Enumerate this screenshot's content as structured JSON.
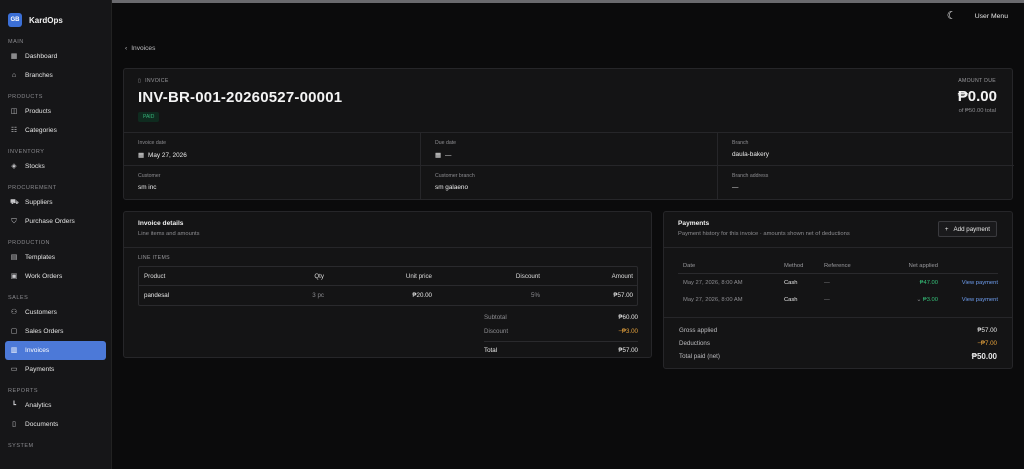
{
  "sidebar": {
    "brand": {
      "logo": "GB",
      "name": "KardOps"
    },
    "sections": [
      {
        "title": "MAIN",
        "items": [
          {
            "label": "Dashboard",
            "icon": "grid-icon"
          },
          {
            "label": "Branches",
            "icon": "store-icon"
          }
        ]
      },
      {
        "title": "PRODUCTS",
        "items": [
          {
            "label": "Products",
            "icon": "box-icon"
          },
          {
            "label": "Categories",
            "icon": "category-icon"
          }
        ]
      },
      {
        "title": "INVENTORY",
        "items": [
          {
            "label": "Stocks",
            "icon": "stock-icon"
          }
        ]
      },
      {
        "title": "PROCUREMENT",
        "items": [
          {
            "label": "Suppliers",
            "icon": "truck-icon"
          },
          {
            "label": "Purchase Orders",
            "icon": "cart-icon"
          }
        ]
      },
      {
        "title": "PRODUCTION",
        "items": [
          {
            "label": "Templates",
            "icon": "template-icon"
          },
          {
            "label": "Work Orders",
            "icon": "workorder-icon"
          }
        ]
      },
      {
        "title": "SALES",
        "items": [
          {
            "label": "Customers",
            "icon": "users-icon"
          },
          {
            "label": "Sales Orders",
            "icon": "order-icon"
          },
          {
            "label": "Invoices",
            "icon": "invoice-icon",
            "active": true
          },
          {
            "label": "Payments",
            "icon": "card-icon"
          }
        ]
      },
      {
        "title": "REPORTS",
        "items": [
          {
            "label": "Analytics",
            "icon": "chart-icon"
          },
          {
            "label": "Documents",
            "icon": "document-icon"
          }
        ]
      },
      {
        "title": "SYSTEM",
        "items": []
      }
    ]
  },
  "topbar": {
    "user_menu": "User Menu"
  },
  "back_link": "Invoices",
  "invoice": {
    "label": "INVOICE",
    "number": "INV-BR-001-20260527-00001",
    "status": "PAID",
    "amount_due_label": "AMOUNT DUE",
    "amount_due": "₱0.00",
    "amount_total": "of ₱50.00 total",
    "meta": {
      "invoice_date_label": "Invoice date",
      "invoice_date": "May 27, 2026",
      "due_date_label": "Due date",
      "due_date": "—",
      "branch_label": "Branch",
      "branch": "daula-bakery",
      "customer_label": "Customer",
      "customer": "sm inc",
      "customer_branch_label": "Customer branch",
      "customer_branch": "sm galaeno",
      "branch_address_label": "Branch address",
      "branch_address": "—"
    }
  },
  "details": {
    "title": "Invoice details",
    "subtitle": "Line items and amounts",
    "line_items_label": "LINE ITEMS",
    "columns": [
      "Product",
      "Qty",
      "Unit price",
      "Discount",
      "Amount"
    ],
    "rows": [
      {
        "product": "pandesal",
        "qty": "3 pc",
        "unit_price": "₱20.00",
        "discount": "5%",
        "amount": "₱57.00"
      }
    ],
    "subtotal_label": "Subtotal",
    "subtotal": "₱60.00",
    "discount_label": "Discount",
    "discount": "−₱3.00",
    "total_label": "Total",
    "total": "₱57.00"
  },
  "payments": {
    "title": "Payments",
    "subtitle": "Payment history for this invoice · amounts shown net of deductions",
    "add_label": "Add payment",
    "columns": [
      "Date",
      "Method",
      "Reference",
      "Net applied"
    ],
    "rows": [
      {
        "date": "May 27, 2026, 8:00 AM",
        "method": "Cash",
        "reference": "—",
        "net": "₱47.00",
        "action": "View payment"
      },
      {
        "date": "May 27, 2026, 8:00 AM",
        "method": "Cash",
        "reference": "—",
        "net": "₱3.00",
        "action": "View payment"
      }
    ],
    "gross_label": "Gross applied",
    "gross": "₱57.00",
    "deductions_label": "Deductions",
    "deductions": "−₱7.00",
    "net_label": "Total paid (net)",
    "net": "₱50.00"
  },
  "colors": {
    "accent": "#4c79d8",
    "paid": "#37b37a",
    "deduction": "#e6a23c",
    "link": "#6f9ef0"
  }
}
